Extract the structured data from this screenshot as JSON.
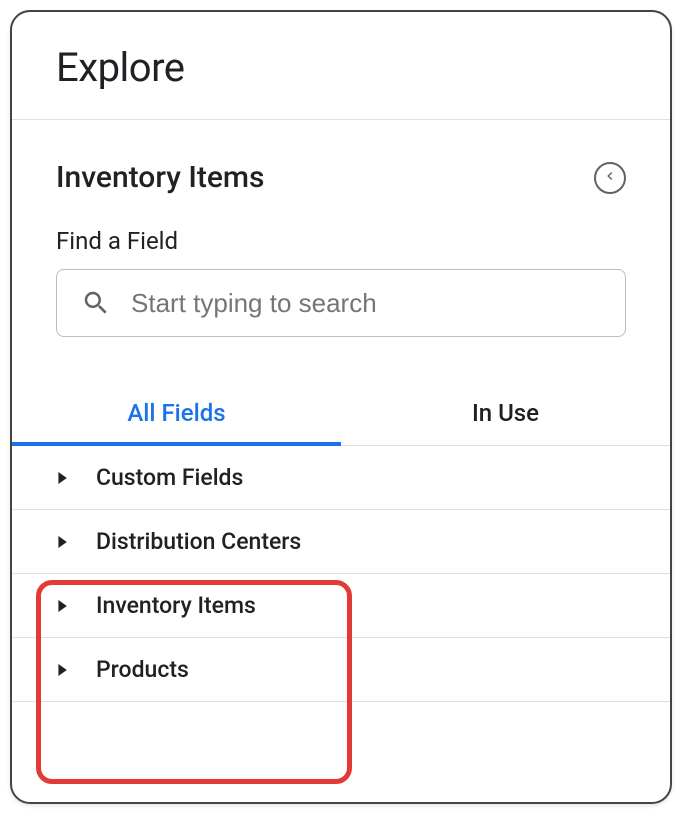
{
  "header": {
    "title": "Explore"
  },
  "panel": {
    "title": "Inventory Items"
  },
  "search": {
    "label": "Find a Field",
    "placeholder": "Start typing to search"
  },
  "tabs": {
    "all_fields": "All Fields",
    "in_use": "In Use"
  },
  "fields": {
    "custom_fields": "Custom Fields",
    "distribution_centers": "Distribution Centers",
    "inventory_items": "Inventory Items",
    "products": "Products"
  }
}
